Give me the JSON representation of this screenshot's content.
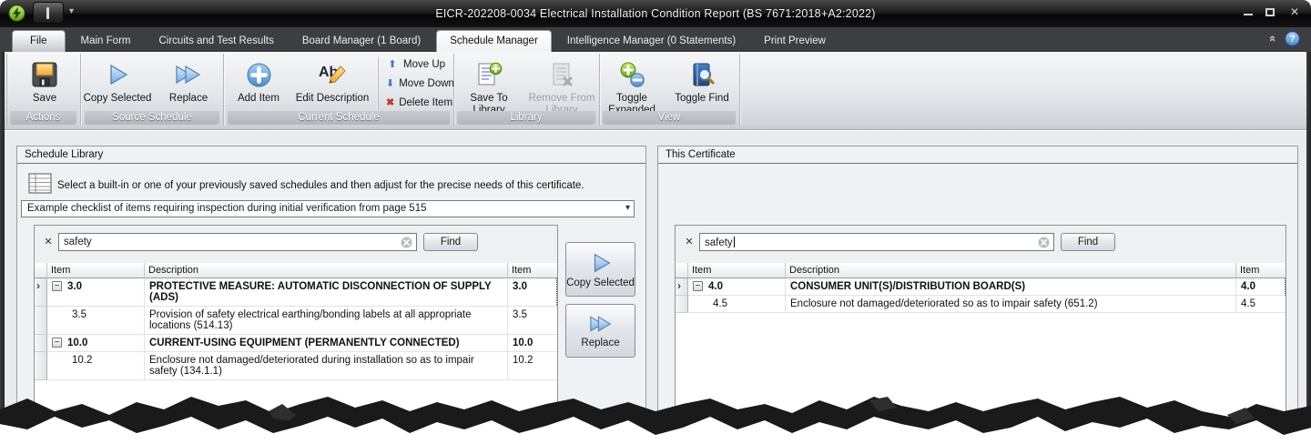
{
  "window": {
    "title": "EICR-202208-0034 Electrical Installation Condition Report (BS 7671:2018+A2:2022)"
  },
  "tabs": [
    {
      "label": "File"
    },
    {
      "label": "Main Form"
    },
    {
      "label": "Circuits and Test Results"
    },
    {
      "label": "Board Manager (1 Board)"
    },
    {
      "label": "Schedule Manager",
      "active": true
    },
    {
      "label": "Intelligence Manager (0 Statements)"
    },
    {
      "label": "Print Preview"
    }
  ],
  "ribbon": {
    "groups": [
      {
        "label": "Actions",
        "buttons": [
          {
            "label": "Save"
          }
        ]
      },
      {
        "label": "Source Schedule",
        "buttons": [
          {
            "label": "Copy Selected"
          },
          {
            "label": "Replace"
          }
        ]
      },
      {
        "label": "Current Schedule",
        "buttons": [
          {
            "label": "Add Item"
          },
          {
            "label": "Edit Description"
          }
        ],
        "small_buttons": [
          {
            "label": "Move Up"
          },
          {
            "label": "Move Down"
          },
          {
            "label": "Delete Item"
          }
        ]
      },
      {
        "label": "Library",
        "buttons": [
          {
            "label": "Save To Library"
          },
          {
            "label": "Remove From Library",
            "disabled": true
          }
        ]
      },
      {
        "label": "View",
        "buttons": [
          {
            "label": "Toggle Expanded"
          },
          {
            "label": "Toggle Find"
          }
        ]
      }
    ]
  },
  "library_panel": {
    "title": "Schedule Library",
    "hint": "Select a built-in or one of your previously saved schedules and then adjust for the precise needs of this certificate.",
    "schedule_dropdown": {
      "value": "Example checklist of items requiring inspection during initial verification from page 515"
    },
    "search": {
      "value": "safety",
      "find_label": "Find"
    },
    "table": {
      "headers": {
        "item": "Item",
        "description": "Description",
        "item2": "Item"
      },
      "rows": [
        {
          "item": "3.0",
          "description": "PROTECTIVE MEASURE: AUTOMATIC DISCONNECTION OF SUPPLY (ADS)",
          "group": true,
          "selected": true
        },
        {
          "item": "3.5",
          "description": "Provision of safety electrical earthing/bonding labels at all appropriate locations (514.13)"
        },
        {
          "item": "10.0",
          "description": "CURRENT-USING EQUIPMENT (PERMANENTLY CONNECTED)",
          "group": true
        },
        {
          "item": "10.2",
          "description": "Enclosure not damaged/deteriorated during installation so as to impair safety (134.1.1)"
        }
      ]
    },
    "transfer_buttons": [
      {
        "label": "Copy Selected"
      },
      {
        "label": "Replace"
      }
    ]
  },
  "certificate_panel": {
    "title": "This Certificate",
    "search": {
      "value": "safety",
      "find_label": "Find"
    },
    "table": {
      "headers": {
        "item": "Item",
        "description": "Description",
        "item2": "Item"
      },
      "rows": [
        {
          "item": "4.0",
          "description": "CONSUMER UNIT(S)/DISTRIBUTION BOARD(S)",
          "group": true,
          "selected": true
        },
        {
          "item": "4.5",
          "description": "Enclosure not damaged/deteriorated so as to impair safety (651.2)"
        }
      ]
    }
  },
  "icons": {
    "dropdown_arrow": "▾",
    "qat_dropdown": "▾",
    "clear_search": "✕",
    "expand_collapse": "−",
    "row_pointer": "›",
    "ribbon_collapse": "«",
    "help_glyph": "?",
    "window_close": "✕",
    "move_up_glyph": "⬆",
    "move_down_glyph": "⬇",
    "delete_glyph": "✖"
  },
  "colors": {
    "titlebar": "#151515",
    "tabstrip": "#3c3e41",
    "ribbon_top": "#f6f7f9",
    "ribbon_bottom": "#c9cdd2",
    "accent_blue": "#5f9bd6",
    "selection_cream": "#f1ede1",
    "group_row_gray": "#d9d9d9"
  }
}
